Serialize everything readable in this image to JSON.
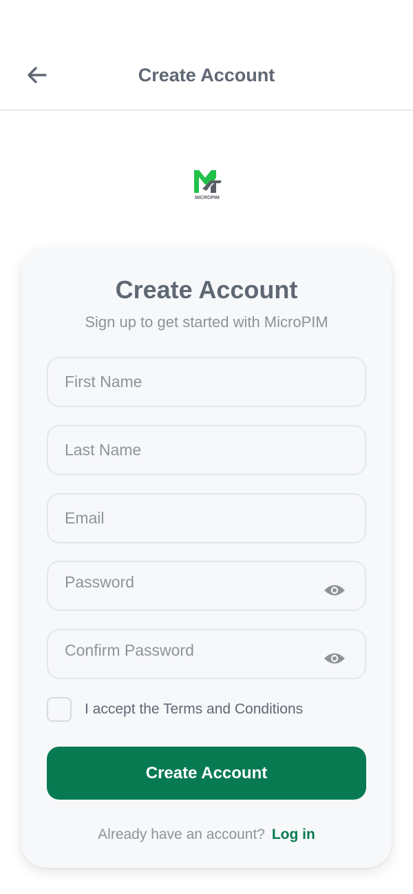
{
  "header": {
    "title": "Create Account",
    "back_icon": "arrow-left-icon"
  },
  "brand": {
    "logo_text": "MICROPIM",
    "primary_color": "#22c14a",
    "secondary_color": "#5a5f66"
  },
  "card": {
    "title": "Create Account",
    "subtitle": "Sign up to get started with MicroPIM"
  },
  "form": {
    "first_name": {
      "placeholder": "First Name",
      "value": ""
    },
    "last_name": {
      "placeholder": "Last Name",
      "value": ""
    },
    "email": {
      "placeholder": "Email",
      "value": ""
    },
    "password": {
      "placeholder": "Password",
      "value": "",
      "toggle_icon": "eye-icon"
    },
    "confirm_password": {
      "placeholder": "Confirm Password",
      "value": "",
      "toggle_icon": "eye-icon"
    },
    "terms": {
      "label": "I accept the Terms and Conditions",
      "checked": false
    },
    "submit_label": "Create Account"
  },
  "footer": {
    "prompt": "Already have an account?",
    "login_label": "Log in"
  },
  "colors": {
    "accent": "#087a52",
    "text_muted": "#8c9399",
    "text_heading": "#5f6773"
  }
}
